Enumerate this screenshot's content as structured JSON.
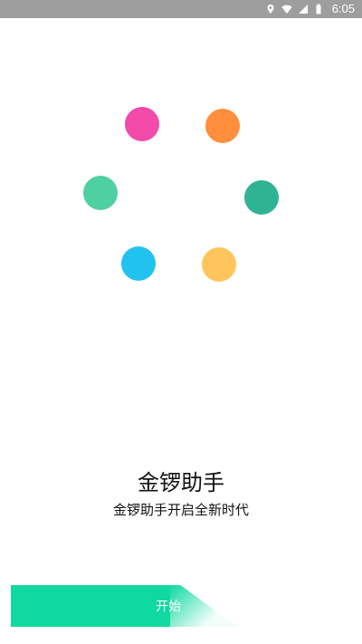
{
  "status_bar": {
    "time": "6:05",
    "icons": [
      "location-icon",
      "wifi-icon",
      "signal-icon",
      "battery-icon"
    ]
  },
  "loader": {
    "dots": [
      {
        "name": "dot-pink",
        "color": "#f24aa8"
      },
      {
        "name": "dot-orange",
        "color": "#ff8f3d"
      },
      {
        "name": "dot-teal",
        "color": "#2fb393"
      },
      {
        "name": "dot-yellow",
        "color": "#ffc55c"
      },
      {
        "name": "dot-blue",
        "color": "#22c2ef"
      },
      {
        "name": "dot-green",
        "color": "#4fd0a0"
      }
    ]
  },
  "app": {
    "title": "金锣助手",
    "subtitle": "金锣助手开启全新时代"
  },
  "start_button": {
    "label": "开始",
    "color": "#0fd9a0"
  }
}
